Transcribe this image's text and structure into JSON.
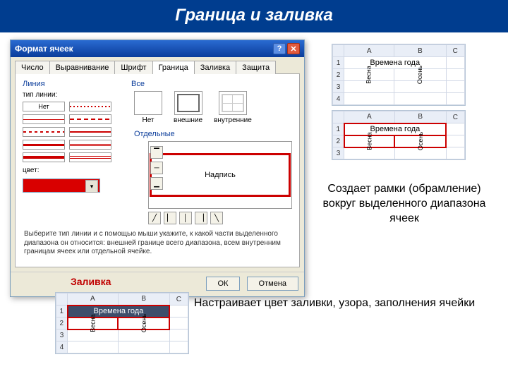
{
  "slide": {
    "title": "Граница и заливка"
  },
  "dialog": {
    "title": "Формат ячеек",
    "tabs": [
      "Число",
      "Выравнивание",
      "Шрифт",
      "Граница",
      "Заливка",
      "Защита"
    ],
    "active_tab": 3,
    "line_section": "Линия",
    "line_type_label": "тип линии:",
    "none_label": "Нет",
    "color_label": "цвет:",
    "color_value": "#d90000",
    "all_section": "Все",
    "presets": {
      "none": "Нет",
      "outer": "внешние",
      "inner": "внутренние"
    },
    "separate_section": "Отдельные",
    "preview_text": "Надпись",
    "help_text": "Выберите тип линии и с помощью мыши укажите, к какой части выделенного диапазона он относится: внешней границе всего диапазона, всем внутренним границам ячеек или отдельной ячейке.",
    "ok": "ОК",
    "cancel": "Отмена"
  },
  "grid": {
    "cols": [
      "A",
      "B",
      "C"
    ],
    "merged_text": "Времена года",
    "cell_a2": "Весна",
    "cell_b2": "Осень"
  },
  "captions": {
    "borders": "Создает рамки (обрамление) вокруг выделенного диапазона ячеек",
    "fill_label": "Заливка",
    "fill": "Настраивает цвет заливки, узора, заполнения ячейки"
  }
}
